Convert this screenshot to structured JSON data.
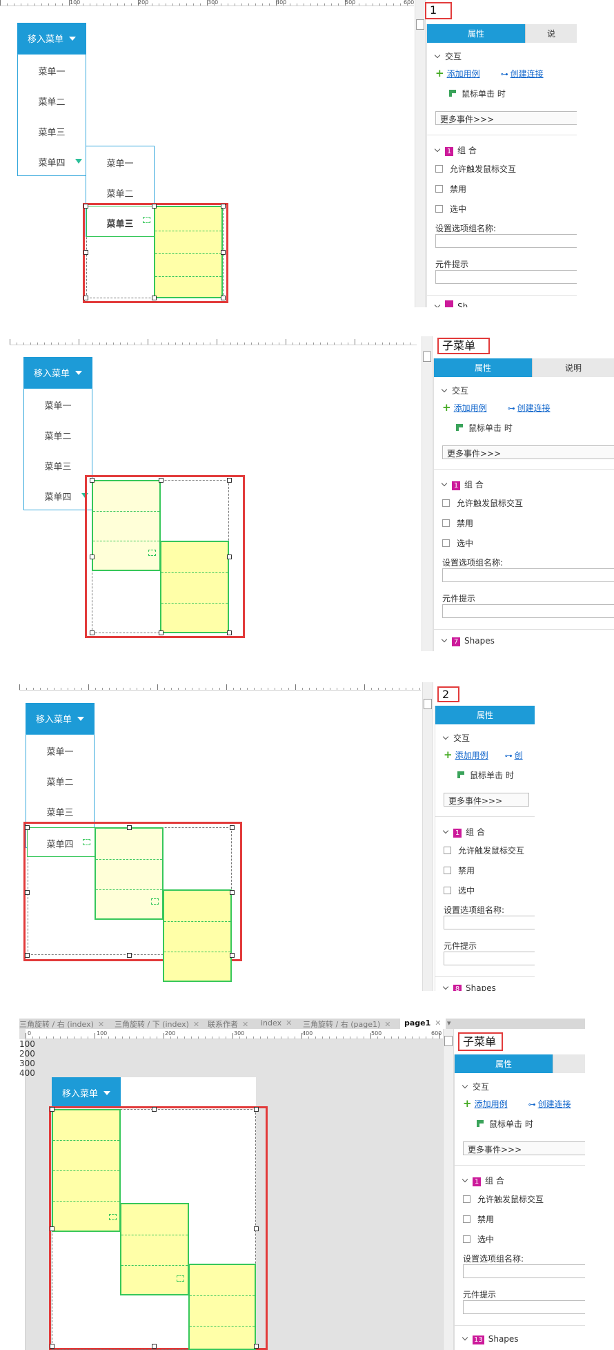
{
  "ruler_labels_a": [
    "100",
    "200",
    "300",
    "400",
    "500",
    "600"
  ],
  "ruler_labels_d": [
    "0",
    "100",
    "200",
    "300",
    "400",
    "500",
    "600"
  ],
  "vruler_labels_d": [
    "100",
    "200",
    "300",
    "400"
  ],
  "menu": {
    "button_label": "移入菜单",
    "items": [
      "菜单一",
      "菜单二",
      "菜单三",
      "菜单四"
    ],
    "submenu_items": [
      "菜单一",
      "菜单二",
      "菜单三"
    ]
  },
  "step_labels": [
    "1",
    "子菜单",
    "2",
    "子菜单"
  ],
  "props": {
    "tab_properties": "属性",
    "tab_notes": "说明",
    "tab_notes_cut": "说",
    "interaction_header": "交互",
    "add_case": "添加用例",
    "create_link": "创建连接",
    "create_link_cut": "创",
    "on_click": "鼠标单击 时",
    "more_events": "更多事件>>>",
    "group_badge": "1",
    "group_label": "组 合",
    "allow_trigger": "允许触发鼠标交互",
    "disabled": "禁用",
    "selected": "选中",
    "option_group_name": "设置选项组名称:",
    "tooltip": "元件提示",
    "shapes_label": "Shapes",
    "shapes_label_cut": "Sh",
    "shapes_label_cut3": "Shapes",
    "shapes_count_b": "7",
    "shapes_count_c": "8",
    "shapes_count_d": "13"
  },
  "doc_tabs": [
    "三角旋转 / 右 (index)",
    "三角旋转 / 下 (index)",
    "联系作者",
    "index",
    "三角旋转 / 右 (page1)",
    "page1"
  ],
  "colors": {
    "accent": "#1d9bd7",
    "highlight": "#e23b3b",
    "block_fill": "#ffffa8",
    "block_border": "#36c75a",
    "badge": "#cc1a9a"
  }
}
